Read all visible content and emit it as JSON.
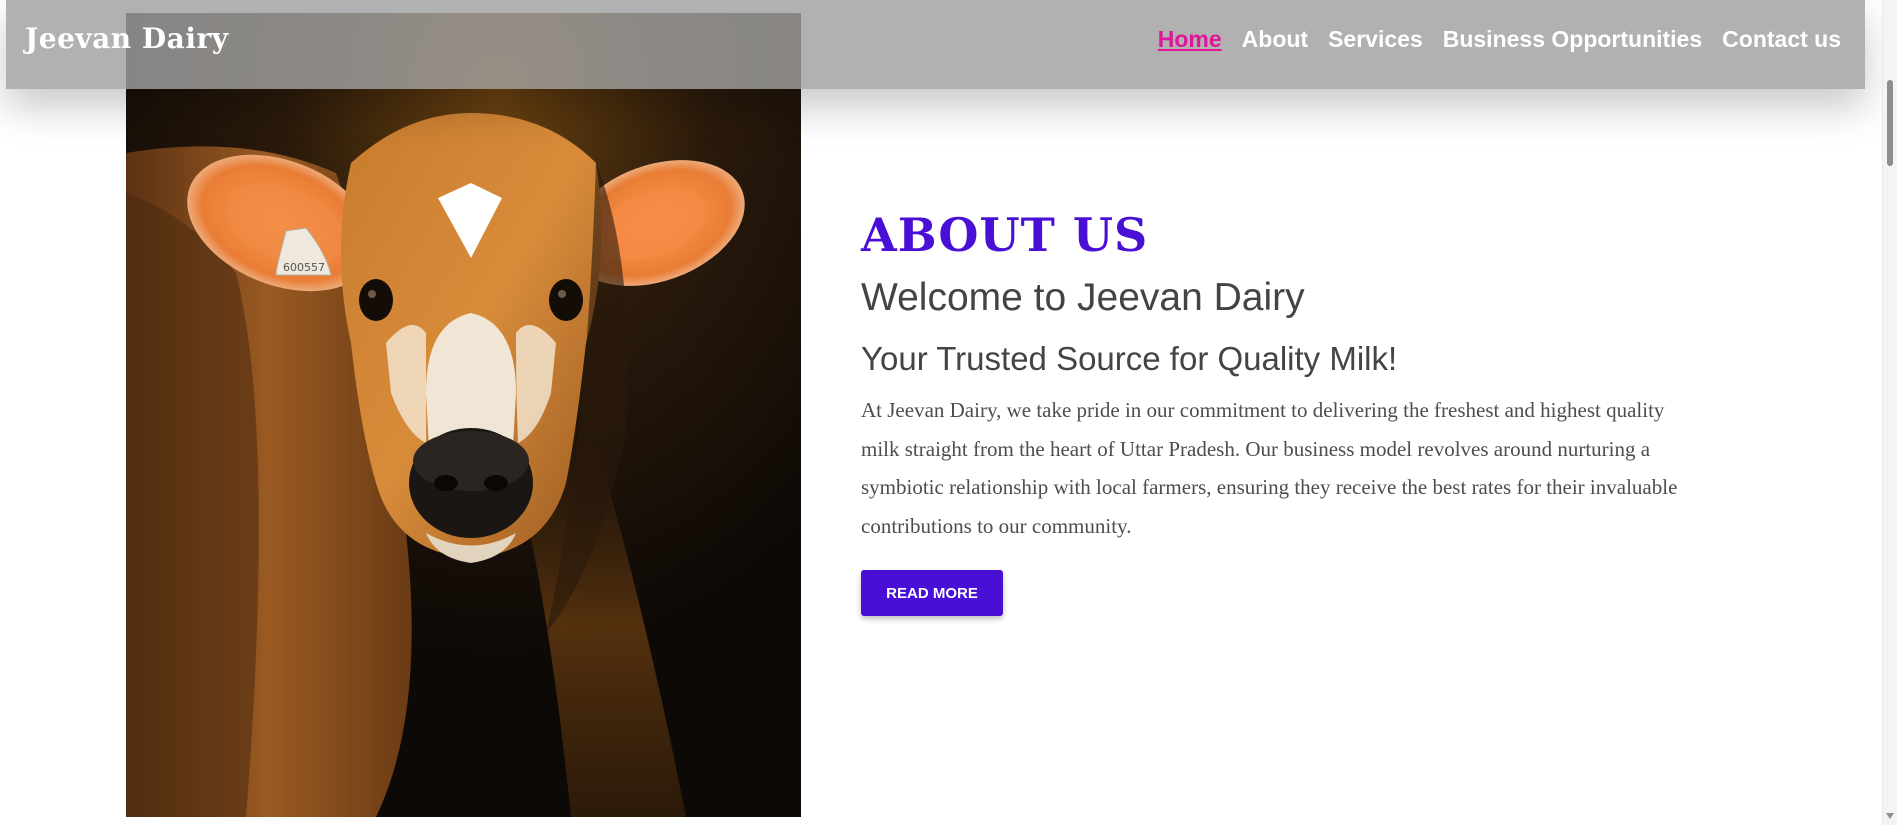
{
  "brand": {
    "name": "Jeevan Dairy"
  },
  "nav": {
    "items": [
      {
        "label": "Home",
        "active": true
      },
      {
        "label": "About",
        "active": false
      },
      {
        "label": "Services",
        "active": false
      },
      {
        "label": "Business Opportunities",
        "active": false
      },
      {
        "label": "Contact us",
        "active": false
      }
    ]
  },
  "about": {
    "kicker": "ABOUT US",
    "heading": "Welcome to Jeevan Dairy",
    "subheading": "Your Trusted Source for Quality Milk!",
    "body": "At Jeevan Dairy, we take pride in our commitment to delivering the freshest and highest quality milk straight from the heart of Uttar Pradesh. Our business model revolves around nurturing a symbiotic relationship with local farmers, ensuring they receive the best rates for their invaluable contributions to our community.",
    "button_label": "READ MORE"
  },
  "image": {
    "ear_tag_text": "600557"
  },
  "colors": {
    "accent": "#4a0fd6",
    "nav_active": "#e0159c",
    "navbar_bg": "#a5a5a5",
    "text": "#444444"
  }
}
